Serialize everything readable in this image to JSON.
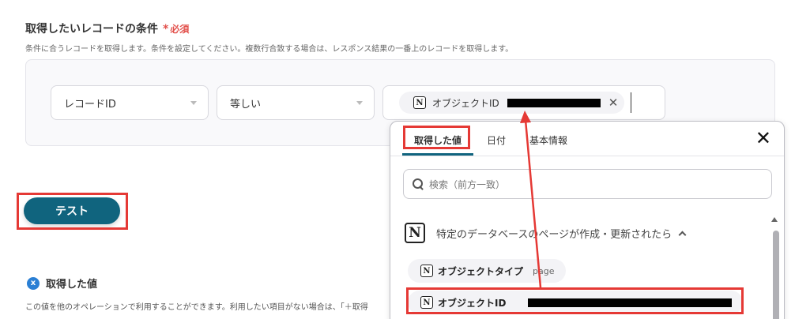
{
  "section": {
    "title": "取得したいレコードの条件",
    "required_star": "*",
    "required_text": "必須",
    "description": "条件に合うレコードを取得します。条件を設定してください。複数行合致する場合は、レスポンス結果の一番上のレコードを取得します。"
  },
  "condition": {
    "field": "レコードID",
    "operator": "等しい",
    "value_chip": {
      "icon": "notion-icon",
      "label": "オブジェクトID"
    }
  },
  "test_button": {
    "label": "テスト"
  },
  "result": {
    "icon_letter": "x",
    "title": "取得した値",
    "description": "この値を他のオペレーションで利用することができます。利用したい項目がない場合は、「＋取得"
  },
  "dropdown": {
    "tabs": [
      {
        "label": "取得した値"
      },
      {
        "label": "日付"
      },
      {
        "label": "基本情報"
      }
    ],
    "search_placeholder": "検索（前方一致）",
    "group": {
      "label": "特定のデータベースのページが作成・更新されたら"
    },
    "items": [
      {
        "label": "オブジェクトタイプ",
        "sub": "page"
      },
      {
        "label": "オブジェクトID"
      }
    ]
  },
  "colors": {
    "accent": "#10647e",
    "highlight": "#e53935",
    "required": "#e2504b"
  }
}
